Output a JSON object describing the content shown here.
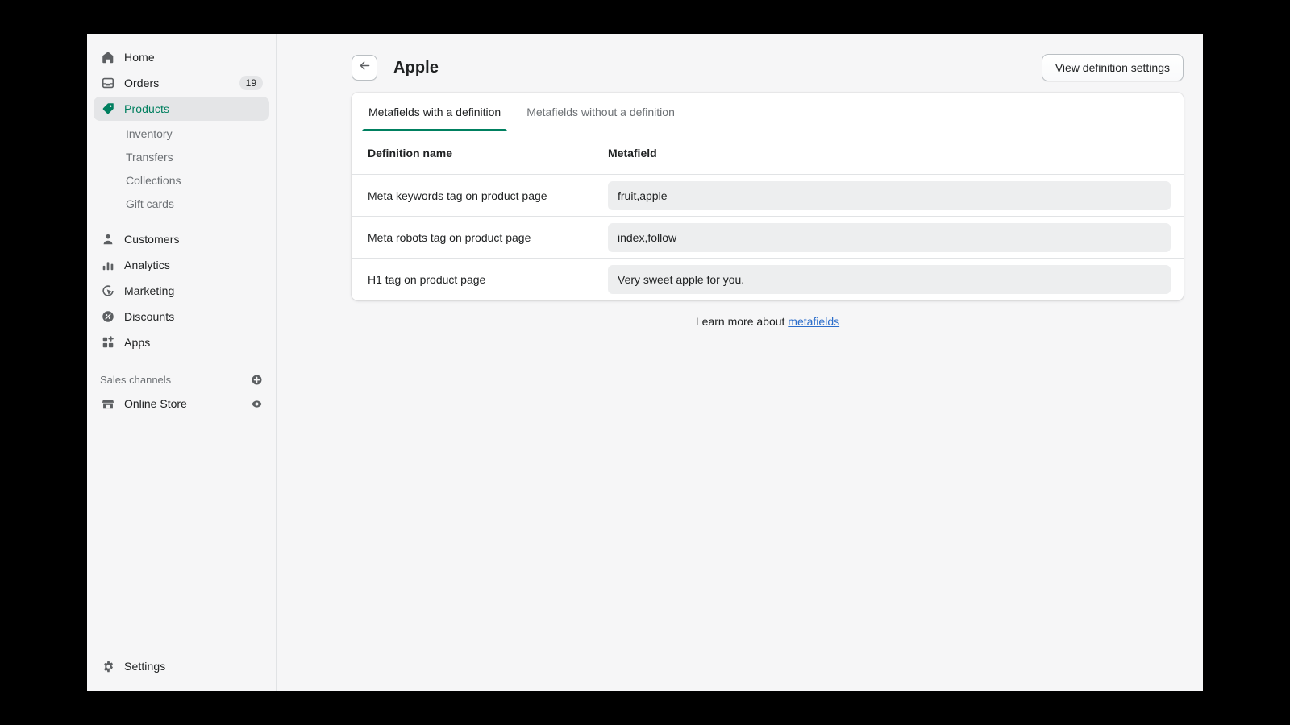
{
  "theme": {
    "accent_green": "#008060",
    "active_green": "#007f5f",
    "link_blue": "#2c6ecb",
    "canvas": "#f6f6f7",
    "card": "#ffffff",
    "value_box": "#edeeef"
  },
  "sidebar": {
    "items": [
      {
        "label": "Home",
        "icon": "home-icon",
        "badge": null,
        "active": false
      },
      {
        "label": "Orders",
        "icon": "orders-inbox-icon",
        "badge": "19",
        "active": false
      },
      {
        "label": "Products",
        "icon": "products-tag-icon",
        "badge": null,
        "active": true
      }
    ],
    "subitems": [
      {
        "label": "Inventory"
      },
      {
        "label": "Transfers"
      },
      {
        "label": "Collections"
      },
      {
        "label": "Gift cards"
      }
    ],
    "items2": [
      {
        "label": "Customers",
        "icon": "person-icon"
      },
      {
        "label": "Analytics",
        "icon": "bar-chart-icon"
      },
      {
        "label": "Marketing",
        "icon": "marketing-target-icon"
      },
      {
        "label": "Discounts",
        "icon": "discount-percent-icon"
      },
      {
        "label": "Apps",
        "icon": "apps-grid-plus-icon"
      }
    ],
    "sales_channels": {
      "title": "Sales channels",
      "add_icon": "plus-circle-icon",
      "channels": [
        {
          "label": "Online Store",
          "icon": "storefront-icon",
          "action_icon": "eye-icon"
        }
      ]
    },
    "footer": {
      "label": "Settings",
      "icon": "gear-icon"
    }
  },
  "header": {
    "back_icon": "arrow-left-icon",
    "title": "Apple",
    "action_button": "View definition settings"
  },
  "card": {
    "tabs": [
      {
        "label": "Metafields with a definition",
        "active": true
      },
      {
        "label": "Metafields without a definition",
        "active": false
      }
    ],
    "columns": {
      "name": "Definition name",
      "metafield": "Metafield"
    },
    "rows": [
      {
        "name": "Meta keywords tag on product page",
        "value": "fruit,apple"
      },
      {
        "name": "Meta robots tag on product page",
        "value": "index,follow"
      },
      {
        "name": "H1 tag on product page",
        "value": "Very sweet apple for you."
      }
    ]
  },
  "footnote": {
    "prefix": "Learn more about ",
    "link": "metafields"
  }
}
